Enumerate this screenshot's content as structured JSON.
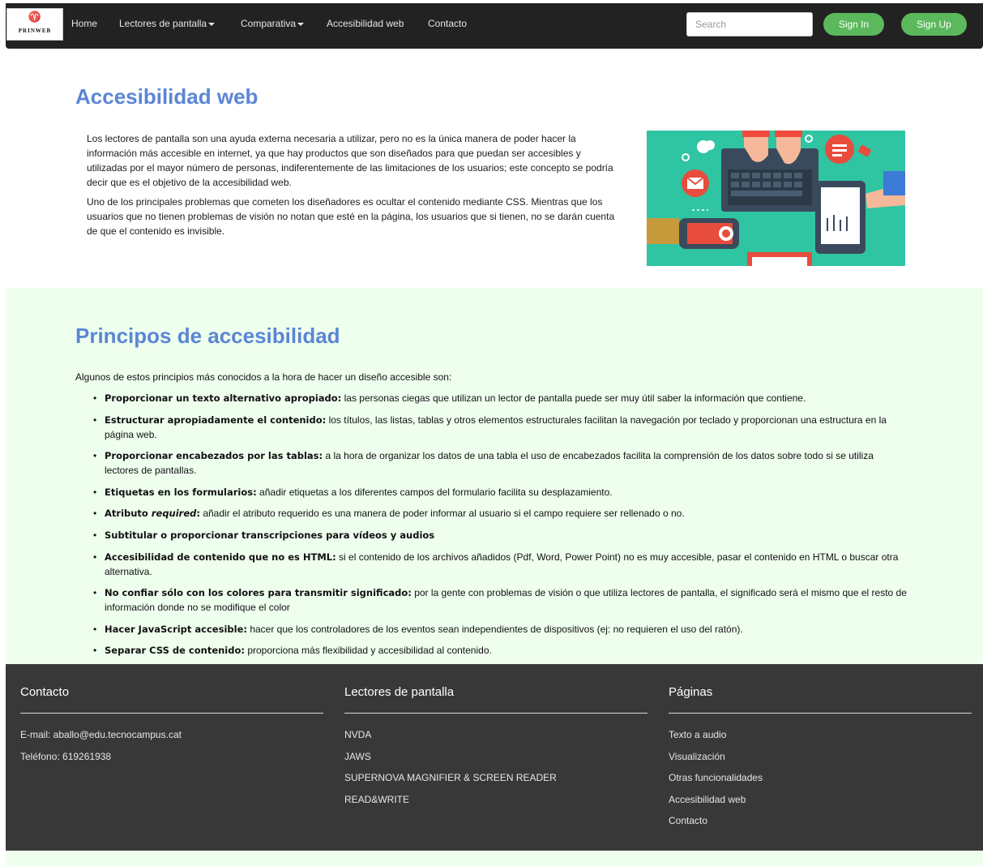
{
  "navbar": {
    "logo_text": "PRINWEB",
    "links": [
      {
        "label": "Home"
      },
      {
        "label": "Lectores de pantalla"
      },
      {
        "label": "Comparativa"
      },
      {
        "label": "Accesibilidad web"
      },
      {
        "label": "Contacto"
      }
    ],
    "search_placeholder": "Search",
    "sign_in": "Sign In",
    "sign_up": "Sign Up"
  },
  "intro": {
    "title": "Accesibilidad web",
    "p1": "Los lectores de pantalla son una ayuda externa necesaria a utilizar, pero no es la única manera de poder hacer la información más accesible en internet, ya que hay productos que son diseñados para que puedan ser accesibles y utilizadas por el mayor número de personas, indiferentemente de las limitaciones de los usuarios; este concepto se podría decir que es el objetivo de la accesibilidad web.",
    "p2": "Uno de los principales problemas que cometen los diseñadores es ocultar el contenido mediante CSS. Mientras que los usuarios que no tienen problemas de visión no notan que esté en la página, los usuarios que si tienen, no se darán cuenta de que el contenido es invisible."
  },
  "principles": {
    "title": "Principos de accesibilidad",
    "lead": "Algunos de estos principios más conocidos a la hora de hacer un diseño accesible son:",
    "items": [
      {
        "bold": "Proporcionar un texto alternativo apropiado:",
        "text": " las personas ciegas que utilizan un lector de pantalla puede ser muy útil saber la información que contiene."
      },
      {
        "bold": "Estructurar apropiadamente el contenido:",
        "text": " los títulos, las listas, tablas y otros elementos estructurales facilitan la navegación por teclado y proporcionan una estructura en la página web."
      },
      {
        "bold": "Proporcionar encabezados por las tablas:",
        "text": " a la hora de organizar los datos de una tabla el uso de encabezados facilita la comprensión de los datos sobre todo si se utiliza lectores de pantallas."
      },
      {
        "bold": "Etiquetas en los formularios:",
        "text": " añadir etiquetas a los diferentes campos del formulario facilita su desplazamiento."
      },
      {
        "bold": "Atributo ",
        "italic": "required",
        "bold2": ":",
        "text": " añadir el atributo requerido es una manera de poder informar al usuario si el campo requiere ser rellenado o no."
      },
      {
        "bold": "Subtitular o proporcionar transcripciones para vídeos y audios",
        "text": ""
      },
      {
        "bold": "Accesibilidad de contenido que no es HTML:",
        "text": " si el contenido de los archivos añadidos (Pdf, Word, Power Point) no es muy accesible, pasar el contenido en HTML o buscar otra alternativa."
      },
      {
        "bold": "No confiar sólo con los colores para transmitir significado:",
        "text": " por la gente con problemas de visión o que utiliza lectores de pantalla, el significado será el mismo que el resto de información donde no se modifique el color"
      },
      {
        "bold": "Hacer JavaScript accesible:",
        "text": " hacer que los controladores de los eventos sean independientes de dispositivos (ej: no requieren el uso del ratón)."
      },
      {
        "bold": "Separar CSS de contenido:",
        "text": " proporciona más flexibilidad y accesibilidad al contenido."
      }
    ]
  },
  "footer": {
    "contact": {
      "title": "Contacto",
      "email": "E-mail: aballo@edu.tecnocampus.cat",
      "phone": "Teléfono: 619261938"
    },
    "readers": {
      "title": "Lectores de pantalla",
      "items": [
        "NVDA",
        "JAWS",
        "SUPERNOVA MAGNIFIER & SCREEN READER",
        "READ&WRITE"
      ]
    },
    "pages": {
      "title": "Páginas",
      "items": [
        "Texto a audio",
        "Visualización",
        "Otras funcionalidades",
        "Accesibilidad web",
        "Contacto"
      ]
    }
  },
  "colors": {
    "navbar_bg": "#222222",
    "heading_blue": "#5b86d6",
    "button_green": "#5cb85c",
    "section_bg": "#eeffee",
    "footer_bg": "#383838",
    "hero_teal": "#2fc4a2"
  }
}
